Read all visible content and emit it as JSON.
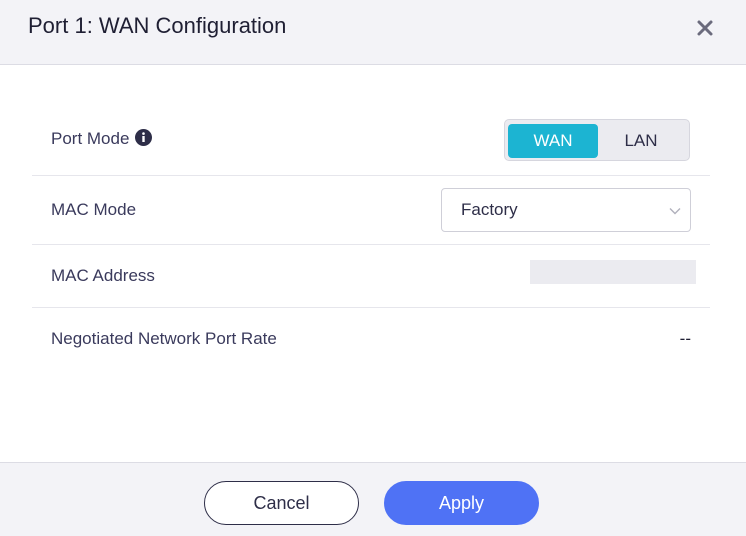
{
  "dialog": {
    "title": "Port 1: WAN Configuration"
  },
  "form": {
    "port_mode": {
      "label": "Port Mode",
      "options": [
        "WAN",
        "LAN"
      ],
      "selected": "WAN"
    },
    "mac_mode": {
      "label": "MAC Mode",
      "value": "Factory"
    },
    "mac_address": {
      "label": "MAC Address",
      "value": ""
    },
    "port_rate": {
      "label": "Negotiated Network Port Rate",
      "value": "--"
    }
  },
  "footer": {
    "cancel_label": "Cancel",
    "apply_label": "Apply"
  },
  "colors": {
    "accent_toggle": "#1cb4d2",
    "primary_button": "#4f72f5",
    "header_bg": "#f3f3f7"
  },
  "icons": {
    "close": "close-icon",
    "info": "info-icon",
    "dropdown": "chevron-down-icon"
  }
}
